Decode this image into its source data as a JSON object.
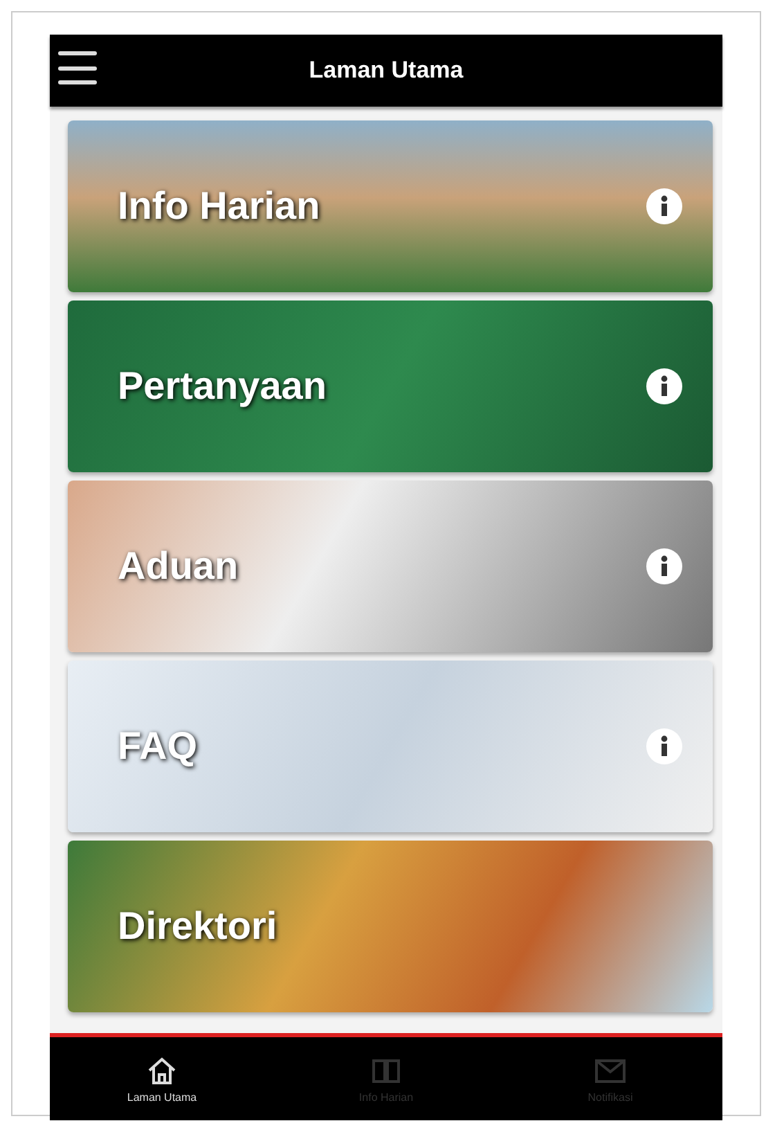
{
  "top_bar": {
    "title": "Laman Utama"
  },
  "cards": [
    {
      "title": "Info Harian",
      "info": true
    },
    {
      "title": "Pertanyaan",
      "info": true
    },
    {
      "title": "Aduan",
      "info": true
    },
    {
      "title": "FAQ",
      "info": true
    },
    {
      "title": "Direktori",
      "info": false
    }
  ],
  "bottom_nav": [
    {
      "label": "Laman Utama",
      "selected": true,
      "kind": "home"
    },
    {
      "label": "Info Harian",
      "selected": false,
      "kind": "book"
    },
    {
      "label": "Notifikasi",
      "selected": false,
      "kind": "mail"
    }
  ]
}
